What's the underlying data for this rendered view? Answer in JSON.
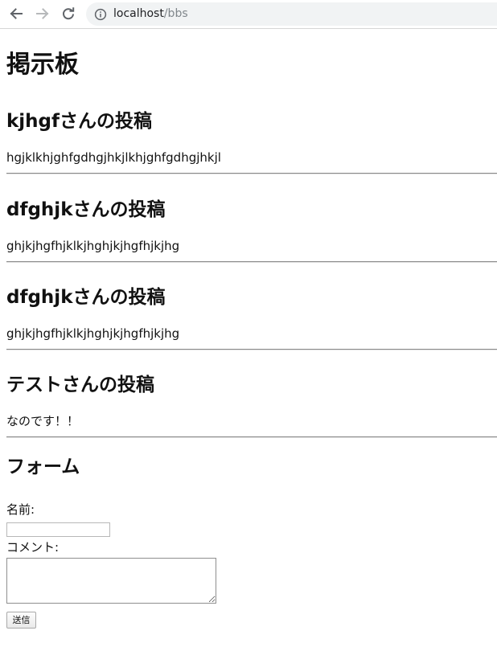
{
  "browser": {
    "url_host": "localhost",
    "url_path": "/bbs"
  },
  "page": {
    "title": "掲示板"
  },
  "posts": [
    {
      "heading": "kjhgfさんの投稿",
      "body": "hgjklkhjghfgdhgjhkjlkhjghfgdhgjhkjl"
    },
    {
      "heading": "dfghjkさんの投稿",
      "body": "ghjkjhgfhjklkjhghjkjhgfhjkjhg"
    },
    {
      "heading": "dfghjkさんの投稿",
      "body": "ghjkjhgfhjklkjhghjkjhgfhjkjhg"
    },
    {
      "heading": "テストさんの投稿",
      "body": "なのです！！"
    }
  ],
  "form": {
    "heading": "フォーム",
    "name_label": "名前:",
    "name_value": "",
    "comment_label": "コメント:",
    "comment_value": "",
    "submit_label": "送信"
  }
}
